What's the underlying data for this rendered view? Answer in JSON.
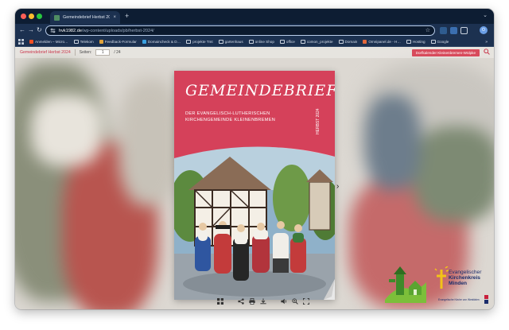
{
  "browser": {
    "tab": {
      "title": "Gemeindebrief Herbst 2024",
      "close_glyph": "×"
    },
    "new_tab_glyph": "+",
    "tab_menu_glyph": "⌄",
    "address": {
      "host": "hvk1982.de",
      "path": "/wp-content/uploads/pb/herbst-2024/"
    },
    "avatar_initial": "O",
    "bookmarks": [
      {
        "label": "Anmelden – Micro…",
        "icon": "microsoft-icon"
      },
      {
        "label": "Telekom",
        "icon": "folder-icon"
      },
      {
        "label": "Feedback-Formular",
        "icon": "feedback-icon"
      },
      {
        "label": "Domaincheck & D…",
        "icon": "domaincheck-icon"
      },
      {
        "label": "projekte Tmt",
        "icon": "folder-icon"
      },
      {
        "label": "gartenhaus",
        "icon": "folder-icon"
      },
      {
        "label": "online Shop",
        "icon": "folder-icon"
      },
      {
        "label": "office",
        "icon": "folder-icon"
      },
      {
        "label": "comon_projekte",
        "icon": "folder-icon"
      },
      {
        "label": "Domain",
        "icon": "folder-icon"
      },
      {
        "label": "Omnipanel.de - H…",
        "icon": "omnipanel-icon"
      },
      {
        "label": "Hosting",
        "icon": "folder-icon"
      },
      {
        "label": "Google",
        "icon": "folder-icon"
      }
    ],
    "bookmarks_more": "»"
  },
  "viewer": {
    "title": "Gemeindebrief Herbst 2024",
    "pages_label": "Seiten:",
    "current_page": "1",
    "total_pages": "/ 24",
    "chip": "Dorfkalender Kleinenbremen-Wülpke"
  },
  "cover": {
    "title": "GEMEINDEBRIEF",
    "subtitle_line1": "DER EVANGELISCH-LUTHERISCHEN",
    "subtitle_line2": "KIRCHENGEMEINDE KLEINENBREMEN",
    "season": "HERBST",
    "year": "2024"
  },
  "logo": {
    "line1": "Evangelischer",
    "line2": "Kirchenkreis",
    "line3": "Minden",
    "sub": "Evangelische Kirche von Westfalen"
  },
  "colors": {
    "accent": "#d5415a",
    "tab_bar": "#0d1d33",
    "toolbar": "#1c3150"
  }
}
